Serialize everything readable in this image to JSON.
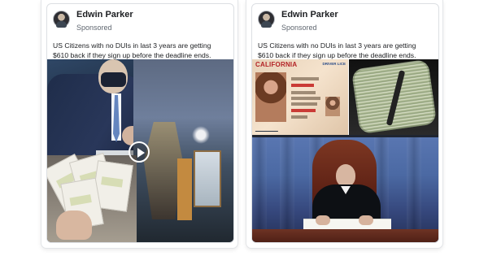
{
  "ads": [
    {
      "advertiser": "Edwin Parker",
      "sponsored_label": "Sponsored",
      "copy": "US Citizens with no DUIs in last 3 years are getting $610 back if they sign up before the deadline ends. HURRY👇"
    },
    {
      "advertiser": "Edwin Parker",
      "sponsored_label": "Sponsored",
      "copy": "US Citizens with no DUIs in last 3 years are getting $610 back if they sign up before the deadline ends. HURRY👇",
      "license_state": "CALIFORNIA",
      "license_label": "DRIVER LICE"
    }
  ],
  "icons": {
    "play_button": "play-icon",
    "avatar": "profile-avatar"
  },
  "colors": {
    "text_primary": "#1c1e21",
    "text_secondary": "#606770",
    "card_border": "#dcdfe3"
  }
}
